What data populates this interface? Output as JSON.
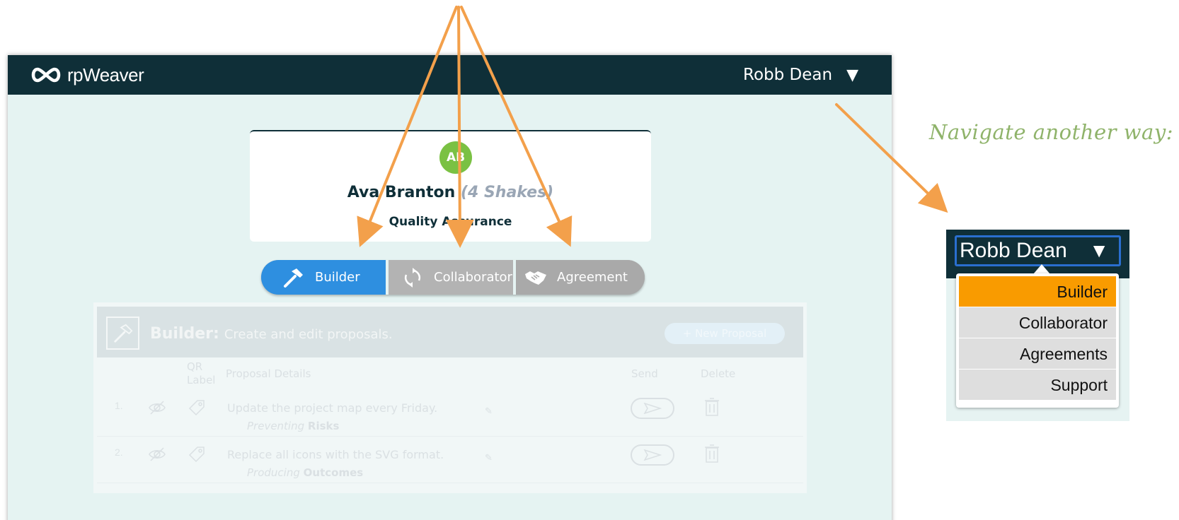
{
  "header": {
    "logo_text": "rpWeaver",
    "user_name": "Robb Dean",
    "caret": "▼"
  },
  "profile": {
    "initials": "AB",
    "name": "Ava Branton",
    "shakes": "(4 Shakes)",
    "role": "Quality Assurance"
  },
  "modes": [
    {
      "label": "Builder",
      "icon": "hammer-icon"
    },
    {
      "label": "Collaborator",
      "icon": "refresh-icon"
    },
    {
      "label": "Agreement",
      "icon": "handshake-icon"
    }
  ],
  "panel": {
    "title_bold": "Builder:",
    "title_rest": "Create and edit proposals.",
    "new_button": "+ New Proposal",
    "columns": {
      "qr": "QR",
      "qr2": "Label",
      "details": "Proposal Details",
      "send": "Send",
      "delete": "Delete"
    },
    "rows": [
      {
        "num": "1.",
        "text": "Update the project map every Friday.",
        "sub_italic": "Preventing",
        "sub_bold": "Risks"
      },
      {
        "num": "2.",
        "text": "Replace all icons with the SVG format.",
        "sub_italic": "Producing",
        "sub_bold": "Outcomes"
      }
    ]
  },
  "annotation": {
    "text": "Navigate another way:"
  },
  "mini_menu": {
    "user_name": "Robb Dean",
    "caret": "▼",
    "items": [
      "Builder",
      "Collaborator",
      "Agreements",
      "Support"
    ]
  },
  "colors": {
    "topbar": "#0f2f38",
    "accent_blue": "#2e8fe0",
    "avatar_green": "#7ac143",
    "arrow_orange": "#f3a04b",
    "menu_active": "#f99b00",
    "annotation_green": "#8fb36a"
  }
}
